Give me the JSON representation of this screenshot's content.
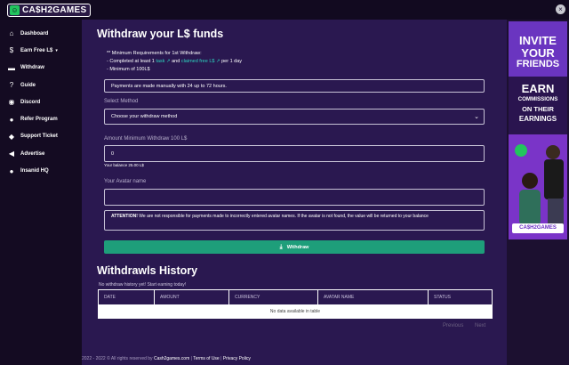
{
  "app": {
    "logo_text": "CA$H2GAMES",
    "logo_mark": "☺"
  },
  "sidebar": {
    "items": [
      {
        "label": "Dashboard",
        "icon": "home-icon",
        "glyph": "⌂"
      },
      {
        "label": "Earn Free L$",
        "icon": "dollar-icon",
        "glyph": "$",
        "has_caret": true
      },
      {
        "label": "Withdraw",
        "icon": "wallet-icon",
        "glyph": "▬"
      },
      {
        "label": "Guide",
        "icon": "question-icon",
        "glyph": "?"
      },
      {
        "label": "Discord",
        "icon": "discord-icon",
        "glyph": "◉"
      },
      {
        "label": "Refer Program",
        "icon": "users-icon",
        "glyph": "●"
      },
      {
        "label": "Support Ticket",
        "icon": "comment-icon",
        "glyph": "◆"
      },
      {
        "label": "Advertise",
        "icon": "megaphone-icon",
        "glyph": "◀"
      },
      {
        "label": "Insanid HQ",
        "icon": "map-pin-icon",
        "glyph": "●"
      }
    ]
  },
  "withdraw": {
    "title": "Withdraw your L$ funds",
    "requirements": {
      "heading": "** Minimum Requirements for 1st Withdraw:",
      "line1_prefix": "- Completed at least 1",
      "line1_link": "task",
      "line1_mid": "and",
      "line1_link2": "claimed free L$",
      "line1_suffix": "per 1 day",
      "line2": "- Minimum of 100L$"
    },
    "notice": "Payments are made manually with 24 up to 72 hours.",
    "method_label": "Select Method",
    "method_value": "Choose your withdraw method",
    "amount_label": "Amount Minimum Withdraw 100 L$",
    "amount_value": "0",
    "balance_text": "Your balance 25.00 L$",
    "avatar_label": "Your Avatar name",
    "avatar_value": "",
    "warning_bold": "ATTENTION!",
    "warning_text": "We are not responsible for payments made to incorrectly entered avatar names. If the avatar is not found, the value will be returned to your balance",
    "button_label": "Withdraw"
  },
  "history": {
    "title": "Withdrawls History",
    "empty_note": "No withdraw history yet! Start earning today!",
    "columns": [
      "DATE",
      "AMOUNT",
      "CURRENCY",
      "AVATAR NAME",
      "STATUS"
    ],
    "empty_row": "No data available in table",
    "prev_label": "Previous",
    "next_label": "Next"
  },
  "footer": {
    "copyright": "2022 - 2022 © All rights reserved by",
    "site": "Cash2games.com",
    "sep": "|",
    "terms": "Terms of Use",
    "privacy": "Privacy Policy"
  },
  "ad": {
    "line1": "INVITE",
    "line2": "YOUR",
    "line3": "FRIENDS",
    "line4": "EARN",
    "line5": "COMMISSIONS",
    "line6": "ON THEIR",
    "line7": "EARNINGS",
    "logo": "CA$H2GAMES"
  },
  "colors": {
    "accent": "#1e9e7a",
    "link": "#2dd4bf",
    "main_bg": "#2a1850",
    "sidebar_bg": "#140b22"
  }
}
